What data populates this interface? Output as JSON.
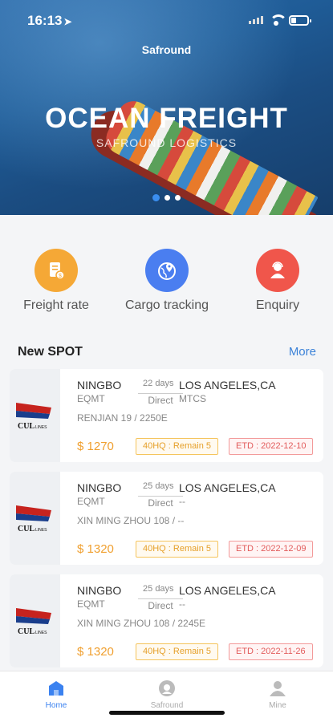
{
  "status_bar": {
    "time": "16:13",
    "location_arrow": "arrow-icon"
  },
  "header": {
    "app_title": "Safround",
    "banner_title": "OCEAN FREIGHT",
    "banner_subtitle": "SAFROUND LOGISTICS"
  },
  "carousel": {
    "pages": 3,
    "active": 0
  },
  "quick_actions": [
    {
      "label": "Freight rate",
      "icon": "freight-rate-icon",
      "color": "#f5a836"
    },
    {
      "label": "Cargo tracking",
      "icon": "globe-pin-icon",
      "color": "#4a7ef0"
    },
    {
      "label": "Enquiry",
      "icon": "customer-service-icon",
      "color": "#f0564b"
    }
  ],
  "section": {
    "title": "New SPOT",
    "more": "More"
  },
  "spots": [
    {
      "carrier": "CUL LINES",
      "pol": "NINGBO",
      "pol_code": "EQMT",
      "days": "22",
      "days_unit": "days",
      "route": "Direct",
      "pod": "LOS ANGELES,CA",
      "pod_code": "MTCS",
      "vessel": "RENJIAN 19 /  2250E",
      "price": "$ 1270",
      "container": "40HQ : Remain 5",
      "etd": "ETD : 2022-12-10"
    },
    {
      "carrier": "CUL LINES",
      "pol": "NINGBO",
      "pol_code": "EQMT",
      "days": "25",
      "days_unit": "days",
      "route": "Direct",
      "pod": "LOS ANGELES,CA",
      "pod_code": "--",
      "vessel": "XIN MING ZHOU 108 /  --",
      "price": "$ 1320",
      "container": "40HQ : Remain 5",
      "etd": "ETD : 2022-12-09"
    },
    {
      "carrier": "CUL LINES",
      "pol": "NINGBO",
      "pol_code": "EQMT",
      "days": "25",
      "days_unit": "days",
      "route": "Direct",
      "pod": "LOS ANGELES,CA",
      "pod_code": "--",
      "vessel": "XIN MING ZHOU 108 /  2245E",
      "price": "$ 1320",
      "container": "40HQ : Remain 5",
      "etd": "ETD : 2022-11-26"
    }
  ],
  "tabs": [
    {
      "label": "Home",
      "icon": "home-icon",
      "active": true
    },
    {
      "label": "Safround",
      "icon": "safround-icon",
      "active": false
    },
    {
      "label": "Mine",
      "icon": "user-icon",
      "active": false
    }
  ],
  "colors": {
    "accent": "#3b82f0",
    "price": "#f0a030",
    "etd": "#e25b5b"
  }
}
